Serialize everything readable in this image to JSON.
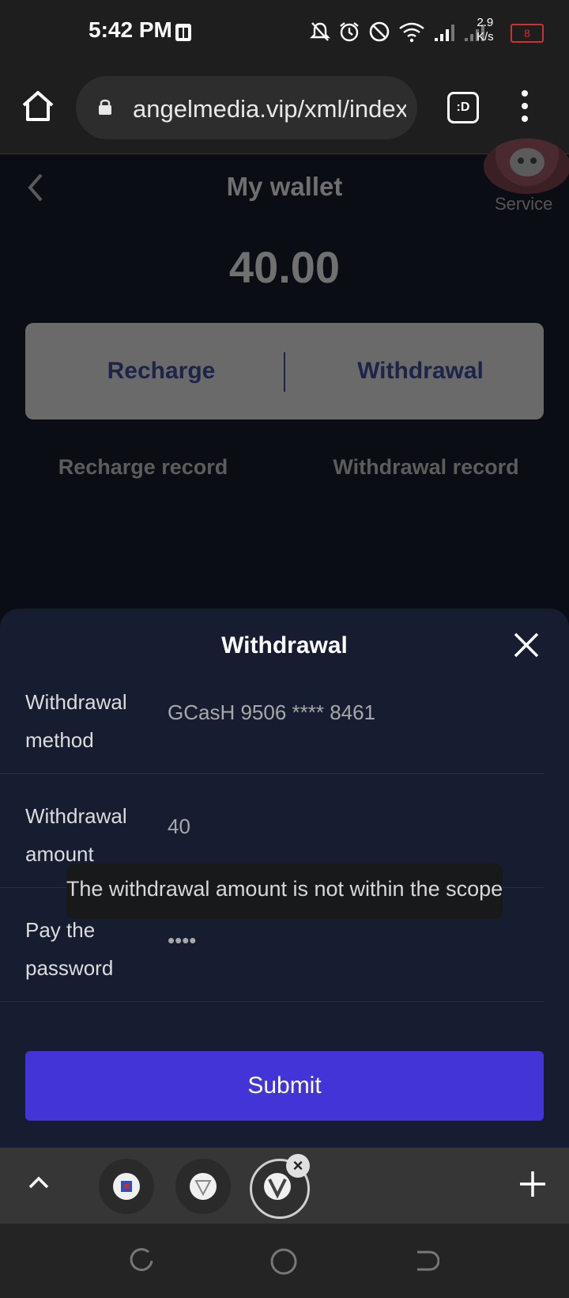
{
  "status_bar": {
    "time": "5:42 PM",
    "net_speed_value": "2.9",
    "net_speed_unit": "K/s",
    "battery": "8",
    "icons": [
      "notifications-off-icon",
      "alarm-icon",
      "do-not-disturb-icon",
      "wifi-icon",
      "signal-icon",
      "signal-icon"
    ]
  },
  "browser": {
    "url": "angelmedia.vip/xml/index",
    "tab_button": ":D"
  },
  "page": {
    "title": "My wallet",
    "service_label": "Service",
    "balance": "40.00",
    "recharge_label": "Recharge",
    "withdrawal_label": "Withdrawal",
    "recharge_record_label": "Recharge record",
    "withdrawal_record_label": "Withdrawal record"
  },
  "withdraw_sheet": {
    "title": "Withdrawal",
    "rows": [
      {
        "label_line1": "Withdrawal",
        "label_line2": "method",
        "value": "GCasH 9506 **** 8461"
      },
      {
        "label_line1": "Withdrawal",
        "label_line2": "amount",
        "value": "40"
      },
      {
        "label_line1": "Pay the",
        "label_line2": "password",
        "value": "••••"
      }
    ],
    "submit_label": "Submit"
  },
  "toast": {
    "message": "The withdrawal amount is not within the scope"
  },
  "colors": {
    "accent": "#4334d8",
    "sheet_bg": "#161d31",
    "battery_low": "#d32f2f"
  }
}
